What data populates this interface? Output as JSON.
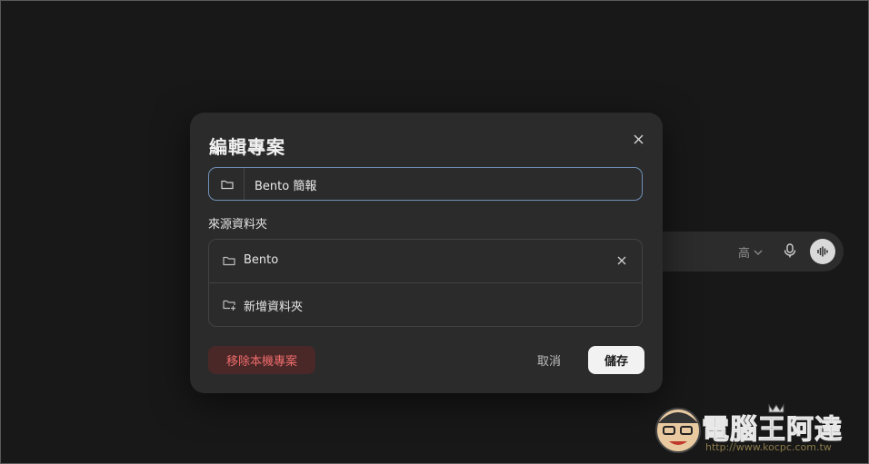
{
  "composer": {
    "model_label": "高"
  },
  "dialog": {
    "title": "編輯專案",
    "name_field": {
      "value": "Bento 簡報",
      "icon": "folder-icon"
    },
    "sources_label": "來源資料夾",
    "folders": [
      {
        "label": "Bento",
        "icon": "folder-icon"
      }
    ],
    "add_folder_label": "新增資料夾",
    "remove_label": "移除本機專案",
    "cancel_label": "取消",
    "save_label": "儲存"
  },
  "watermark": {
    "brand": "電腦王阿達",
    "url": "http://www.kocpc.com.tw"
  },
  "colors": {
    "background": "#181818",
    "dialog": "#2b2b2b",
    "focus_border": "#6f8fb6",
    "danger_text": "#ef6b6b",
    "danger_bg": "#4a2828",
    "primary_bg": "#f2f2f2"
  }
}
